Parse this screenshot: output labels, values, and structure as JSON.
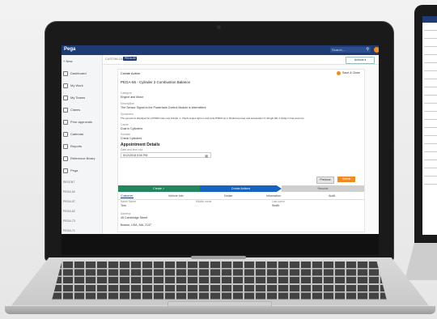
{
  "app": {
    "brand": "Pega"
  },
  "header": {
    "search_placeholder": "Search...",
    "search_icon": "search-icon"
  },
  "sidebar": {
    "items": [
      {
        "label": "New",
        "icon": "plus-icon"
      },
      {
        "label": "Dashboard",
        "icon": "dashboard-icon"
      },
      {
        "label": "My Work",
        "icon": "briefcase-icon"
      },
      {
        "label": "My Teams",
        "icon": "users-icon"
      },
      {
        "label": "Claims",
        "icon": "document-icon"
      },
      {
        "label": "Prior approvals",
        "icon": "check-icon"
      },
      {
        "label": "Calendar",
        "icon": "calendar-icon"
      },
      {
        "label": "Reports",
        "icon": "chart-icon"
      },
      {
        "label": "Reference library",
        "icon": "book-icon"
      },
      {
        "label": "Pega",
        "icon": "pega-icon"
      }
    ],
    "sections": [
      "RECENT",
      "PEGA-50",
      "PEGA-57",
      "PEGA-62",
      "PEGA-73",
      "PEGA-71"
    ]
  },
  "breadcrumb": {
    "path": "CUSTOM-CASE",
    "chip": "PEGA-55"
  },
  "actions_label": "Actions ▾",
  "case": {
    "header": "Create Action",
    "save_close": "Save & Close",
    "title": "PEGA-55 - Cylinder 2 Combustion Balance",
    "fields": [
      {
        "label": "Category",
        "value": "Engine and Motor"
      },
      {
        "label": "Description",
        "value": "The Sensor Signal to the Powertrain Control Module is intermittent"
      },
      {
        "label": "Symptoms",
        "value": "The symptoms displayed for a P0300 code may include: 1. Check engine light on and code P0300 set 2. Reduced power and acceleration 3. Rough idle 4. Delay in fuel economy"
      },
      {
        "label": "Cause",
        "value": "Dust in Cylinders"
      },
      {
        "label": "Solution",
        "value": "Check Cylinders"
      }
    ],
    "appointment": {
      "heading": "Appointment Details",
      "label": "Date and time slot",
      "value": "5/12/2018 5:00 PM"
    },
    "buttons": {
      "previous": "Previous",
      "submit": "Submit"
    },
    "stages": [
      {
        "label": "Create",
        "state": "done",
        "color": "#24865e"
      },
      {
        "label": "Create Actions",
        "state": "active",
        "color": "#1565c0"
      },
      {
        "label": "Resolve",
        "state": "todo",
        "color": "#cfcfcf"
      }
    ],
    "tabs": [
      "Customer",
      "Vehicle Info",
      "Dealer",
      "Information",
      "Audit"
    ],
    "customer": {
      "fields": [
        {
          "label": "Name Name",
          "value": "Tom"
        },
        {
          "label": "Middle name",
          "value": "--"
        },
        {
          "label": "Last name",
          "value": "Smith"
        },
        {
          "label": "Address",
          "value": "45 Cambridge Street"
        },
        {
          "label": "",
          "value": "Boston, USA, MA, 2137"
        }
      ]
    }
  }
}
